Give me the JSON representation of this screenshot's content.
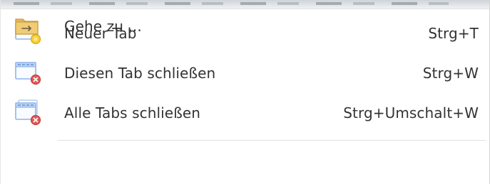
{
  "menu": {
    "items": [
      {
        "label": "Neuer Tab",
        "shortcut": "Strg+T",
        "icon": "new-tab-icon"
      },
      {
        "label": "Diesen Tab schließen",
        "shortcut": "Strg+W",
        "icon": "close-tab-icon"
      },
      {
        "label": "Alle Tabs schließen",
        "shortcut": "Strg+Umschalt+W",
        "icon": "close-all-tabs-icon"
      },
      {
        "label": "Gehe zu ...",
        "shortcut": "",
        "icon": "folder-go-icon"
      }
    ]
  },
  "colors": {
    "text": "#333333",
    "separator": "#e2e2e2",
    "window_blue": "#8fb4e8",
    "new_yellow": "#f4cf36",
    "close_red": "#e05a5a",
    "folder_gold": "#e3bb5b"
  }
}
